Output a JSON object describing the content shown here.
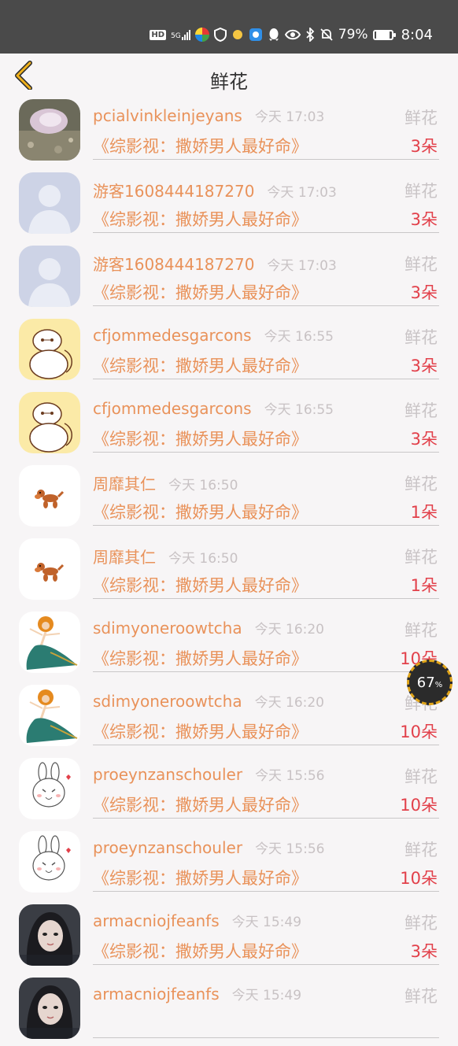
{
  "status_bar": {
    "hd": "HD",
    "network": "5G",
    "battery": "79%",
    "battery_level": 0.79,
    "time": "8:04"
  },
  "header": {
    "title": "鲜花",
    "back_icon": "chevron-left-icon",
    "accent_color": "#f0b11c"
  },
  "rows": [
    {
      "name": "pcialvinkleinjeyans",
      "time": "今天 17:03",
      "tag": "鲜花",
      "book": "《综影视：撒娇男人最好命》",
      "count": "3朵",
      "avatar": "photo-rock"
    },
    {
      "name": "游客1608444187270",
      "time": "今天 17:03",
      "tag": "鲜花",
      "book": "《综影视：撒娇男人最好命》",
      "count": "3朵",
      "avatar": "default-user"
    },
    {
      "name": "游客1608444187270",
      "time": "今天 17:03",
      "tag": "鲜花",
      "book": "《综影视：撒娇男人最好命》",
      "count": "3朵",
      "avatar": "default-user"
    },
    {
      "name": "cfjommedesgarcons",
      "time": "今天 16:55",
      "tag": "鲜花",
      "book": "《综影视：撒娇男人最好命》",
      "count": "3朵",
      "avatar": "baymax"
    },
    {
      "name": "cfjommedesgarcons",
      "time": "今天 16:55",
      "tag": "鲜花",
      "book": "《综影视：撒娇男人最好命》",
      "count": "3朵",
      "avatar": "baymax"
    },
    {
      "name": "周靡其仁",
      "time": "今天 16:50",
      "tag": "鲜花",
      "book": "《综影视：撒娇男人最好命》",
      "count": "1朵",
      "avatar": "balloon-dog"
    },
    {
      "name": "周靡其仁",
      "time": "今天 16:50",
      "tag": "鲜花",
      "book": "《综影视：撒娇男人最好命》",
      "count": "1朵",
      "avatar": "balloon-dog"
    },
    {
      "name": "sdimyoneroowtcha",
      "time": "今天 16:20",
      "tag": "鲜花",
      "book": "《综影视：撒娇男人最好命》",
      "count": "10朵",
      "avatar": "dancer"
    },
    {
      "name": "sdimyoneroowtcha",
      "time": "今天 16:20",
      "tag": "鲜花",
      "book": "《综影视：撒娇男人最好命》",
      "count": "10朵",
      "avatar": "dancer"
    },
    {
      "name": "proeynzanschouler",
      "time": "今天 15:56",
      "tag": "鲜花",
      "book": "《综影视：撒娇男人最好命》",
      "count": "10朵",
      "avatar": "rabbit"
    },
    {
      "name": "proeynzanschouler",
      "time": "今天 15:56",
      "tag": "鲜花",
      "book": "《综影视：撒娇男人最好命》",
      "count": "10朵",
      "avatar": "rabbit"
    },
    {
      "name": "armacniojfeanfs",
      "time": "今天 15:49",
      "tag": "鲜花",
      "book": "《综影视：撒娇男人最好命》",
      "count": "3朵",
      "avatar": "girl-photo"
    },
    {
      "name": "armacniojfeanfs",
      "time": "今天 15:49",
      "tag": "鲜花",
      "book": "",
      "count": "",
      "avatar": "girl-photo"
    }
  ],
  "float_badge": {
    "value": "67",
    "unit": "%",
    "level": 0.67
  },
  "colors": {
    "name": "#e9925a",
    "count": "#e2404a",
    "muted": "#c9c4c6"
  }
}
